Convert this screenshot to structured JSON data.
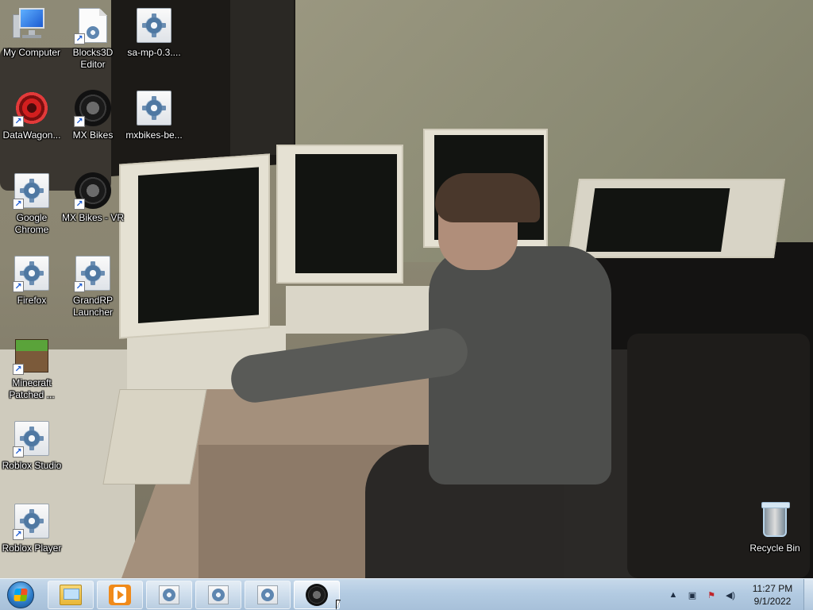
{
  "desktop": {
    "icons": [
      {
        "label": "My Computer",
        "icon": "computer-icon"
      },
      {
        "label": "Blocks3D Editor",
        "icon": "generic-app-icon"
      },
      {
        "label": "sa-mp-0.3....",
        "icon": "generic-app-icon"
      },
      {
        "label": "DataWagon...",
        "icon": "datawagon-icon"
      },
      {
        "label": "MX Bikes",
        "icon": "tire-icon"
      },
      {
        "label": "mxbikes-be...",
        "icon": "generic-app-icon"
      },
      {
        "label": "Google Chrome",
        "icon": "generic-app-icon"
      },
      {
        "label": "MX Bikes - VR",
        "icon": "tire-icon"
      },
      {
        "label": "Firefox",
        "icon": "generic-app-icon"
      },
      {
        "label": "GrandRP Launcher",
        "icon": "generic-app-icon"
      },
      {
        "label": "Minecraft Patched ...",
        "icon": "grass-block-icon"
      },
      {
        "label": "Roblox Studio",
        "icon": "generic-app-icon"
      },
      {
        "label": "Roblox Player",
        "icon": "generic-app-icon"
      },
      {
        "label": "Recycle Bin",
        "icon": "recycle-bin-icon"
      }
    ]
  },
  "taskbar": {
    "start": "windows-orb-icon",
    "pinned": [
      {
        "name": "explorer",
        "icon": "folder-icon"
      },
      {
        "name": "media-player",
        "icon": "media-player-icon"
      },
      {
        "name": "app-1",
        "icon": "generic-app-icon"
      },
      {
        "name": "app-2",
        "icon": "generic-app-icon"
      },
      {
        "name": "app-3",
        "icon": "generic-app-icon"
      },
      {
        "name": "mx-bikes",
        "icon": "tire-icon"
      }
    ],
    "tray": {
      "icons": [
        "show-hidden-icons-arrow",
        "network-icon",
        "action-center-flag-icon",
        "volume-icon"
      ],
      "time": "11:27 PM",
      "date": "9/1/2022"
    }
  }
}
